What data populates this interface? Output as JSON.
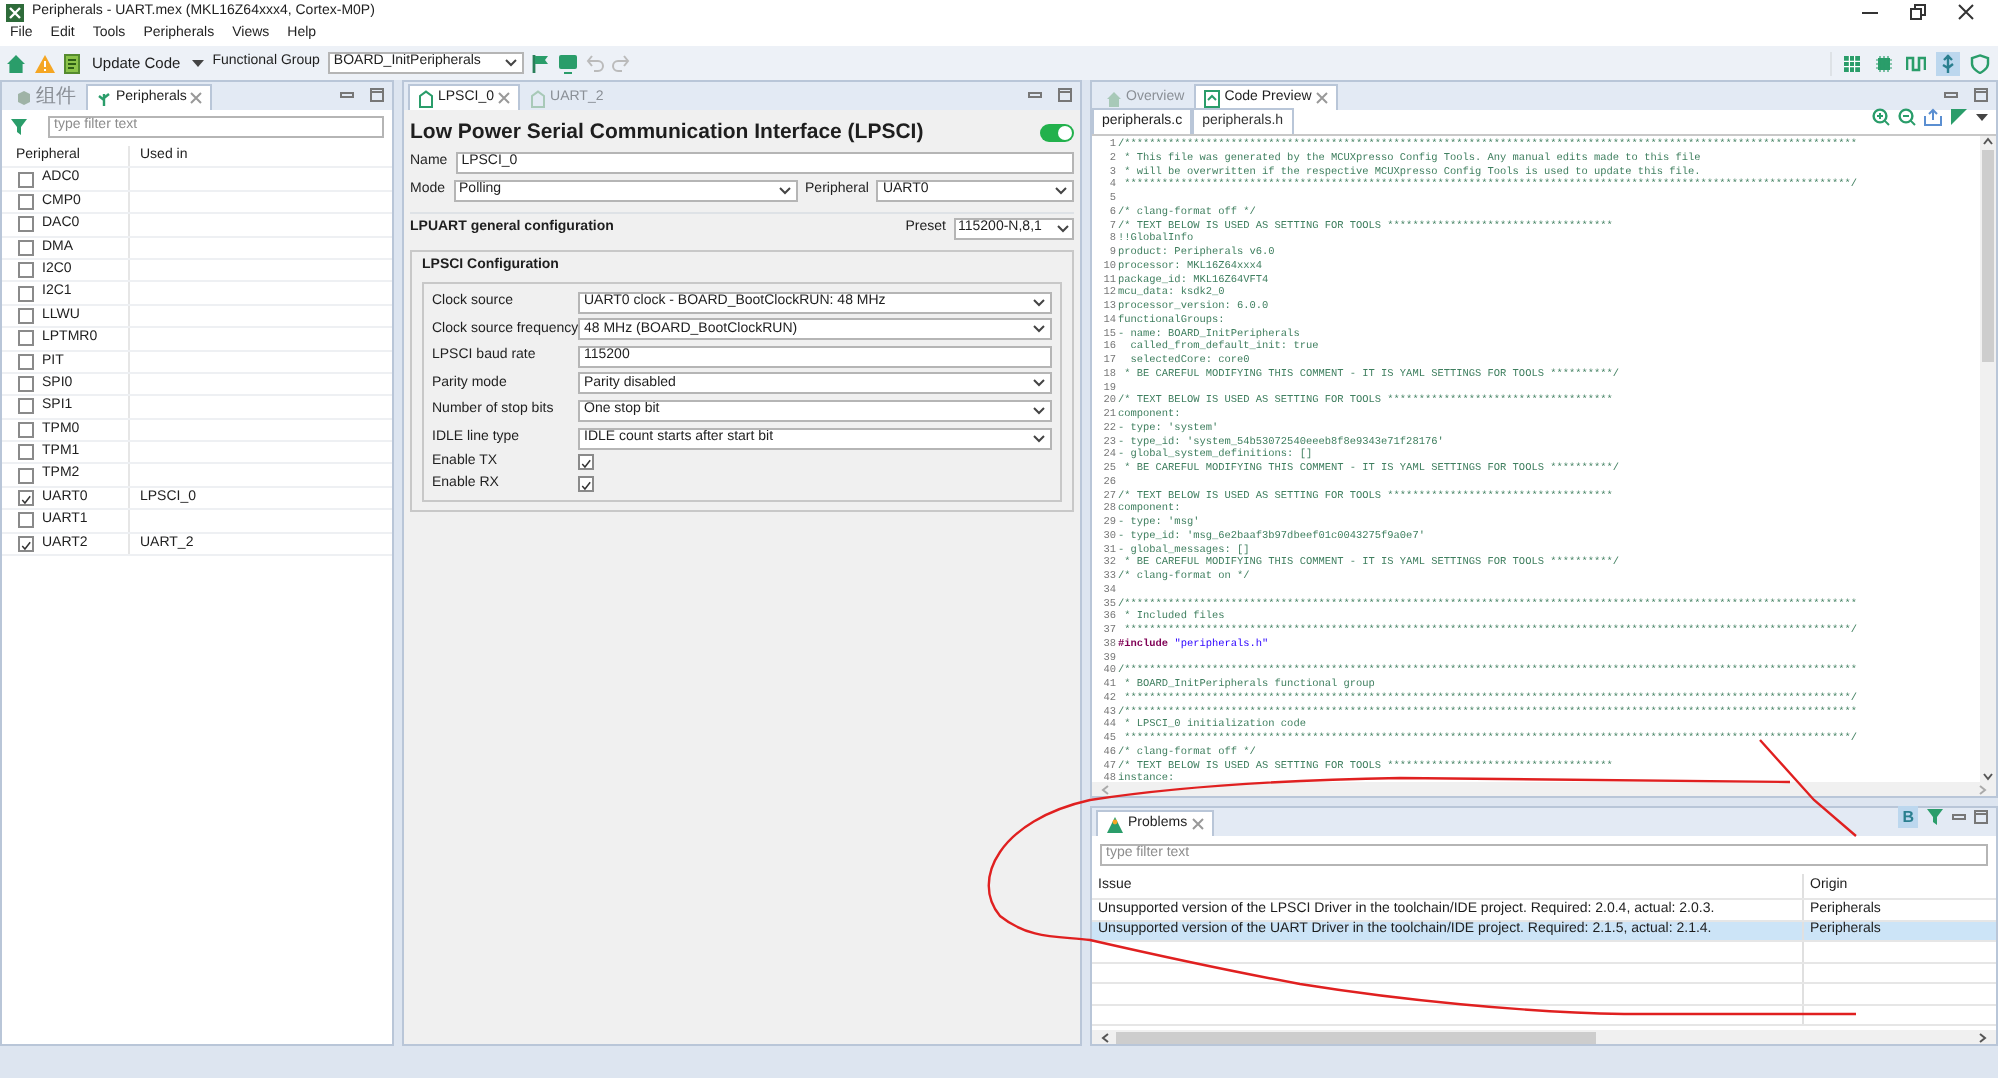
{
  "window": {
    "title": "Peripherals - UART.mex (MKL16Z64xxx4, Cortex-M0P)"
  },
  "menu": [
    "File",
    "Edit",
    "Tools",
    "Peripherals",
    "Views",
    "Help"
  ],
  "toolbar": {
    "update_button": "Update Code",
    "functional_group_label": "Functional Group",
    "functional_group": "BOARD_InitPeripherals",
    "perspectives": [
      {
        "kind": "grid",
        "selected": false
      },
      {
        "kind": "chip",
        "selected": false
      },
      {
        "kind": "wave",
        "selected": false
      },
      {
        "kind": "pin",
        "selected": true
      },
      {
        "kind": "shield",
        "selected": false
      }
    ]
  },
  "left_panel": {
    "tabs": [
      {
        "label": "组件",
        "selected": false
      },
      {
        "label": "Peripherals",
        "selected": true
      }
    ],
    "filter": {
      "placeholder": "type filter text"
    },
    "columns": [
      "Peripheral",
      "Used in"
    ],
    "rows": [
      {
        "name": "ADC0",
        "checked": false
      },
      {
        "name": "CMP0",
        "checked": false
      },
      {
        "name": "DAC0",
        "checked": false
      },
      {
        "name": "DMA",
        "checked": false
      },
      {
        "name": "I2C0",
        "checked": false
      },
      {
        "name": "I2C1",
        "checked": false
      },
      {
        "name": "LLWU",
        "checked": false
      },
      {
        "name": "LPTMR0",
        "checked": false
      },
      {
        "name": "PIT",
        "checked": false
      },
      {
        "name": "SPI0",
        "checked": false
      },
      {
        "name": "SPI1",
        "checked": false
      },
      {
        "name": "TPM0",
        "checked": false
      },
      {
        "name": "TPM1",
        "checked": false
      },
      {
        "name": "TPM2",
        "checked": false
      },
      {
        "name": "UART0",
        "checked": true,
        "used_in": "LPSCI_0"
      },
      {
        "name": "UART1",
        "checked": false
      },
      {
        "name": "UART2",
        "checked": true,
        "used_in": "UART_2"
      }
    ]
  },
  "editor": {
    "tabs": [
      {
        "label": "LPSCI_0",
        "selected": true
      },
      {
        "label": "UART_2",
        "selected": false
      }
    ],
    "title": "Low Power Serial Communication Interface (LPSCI)",
    "enabled": true,
    "name_label": "Name",
    "name": "LPSCI_0",
    "mode_label": "Mode",
    "mode": "Polling",
    "peripheral_label": "Peripheral",
    "peripheral": "UART0",
    "section": "LPUART general configuration",
    "preset_label": "Preset",
    "preset": "115200-N,8,1",
    "group": "LPSCI Configuration",
    "settings": [
      {
        "label": "Clock source",
        "kind": "select",
        "value": "UART0 clock - BOARD_BootClockRUN: 48 MHz"
      },
      {
        "label": "Clock source frequency",
        "kind": "select",
        "value": "48 MHz (BOARD_BootClockRUN)"
      },
      {
        "label": "LPSCI baud rate",
        "kind": "text",
        "value": "115200"
      },
      {
        "label": "Parity mode",
        "kind": "select",
        "value": "Parity disabled"
      },
      {
        "label": "Number of stop bits",
        "kind": "select",
        "value": "One stop bit"
      },
      {
        "label": "IDLE line type",
        "kind": "select",
        "value": "IDLE count starts after start bit"
      },
      {
        "label": "Enable TX",
        "kind": "checkbox",
        "checked": true
      },
      {
        "label": "Enable RX",
        "kind": "checkbox",
        "checked": true
      }
    ]
  },
  "code_preview": {
    "tabs": [
      {
        "label": "Overview",
        "selected": false
      },
      {
        "label": "Code Preview",
        "selected": true
      }
    ],
    "files": [
      {
        "label": "peripherals.c",
        "selected": true
      },
      {
        "label": "peripherals.h",
        "selected": false
      }
    ],
    "lines": [
      {
        "number": "1",
        "text": "/*********************************************************************************************************************"
      },
      {
        "number": "2",
        "text": " * This file was generated by the MCUXpresso Config Tools. Any manual edits made to this file"
      },
      {
        "number": "3",
        "text": " * will be overwritten if the respective MCUXpresso Config Tools is used to update this file."
      },
      {
        "number": "4",
        "text": " ********************************************************************************************************************/"
      },
      {
        "number": "5"
      },
      {
        "number": "6",
        "text": "/* clang-format off */"
      },
      {
        "number": "7",
        "text": "/* TEXT BELOW IS USED AS SETTING FOR TOOLS ************************************"
      },
      {
        "number": "8",
        "text": "!!GlobalInfo"
      },
      {
        "number": "9",
        "text": "product: Peripherals v6.0"
      },
      {
        "number": "10",
        "text": "processor: MKL16Z64xxx4"
      },
      {
        "number": "11",
        "text": "package_id: MKL16Z64VFT4"
      },
      {
        "number": "12",
        "text": "mcu_data: ksdk2_0"
      },
      {
        "number": "13",
        "text": "processor_version: 6.0.0"
      },
      {
        "number": "14",
        "text": "functionalGroups:"
      },
      {
        "number": "15",
        "text": "- name: BOARD_InitPeripherals"
      },
      {
        "number": "16",
        "text": "  called_from_default_init: true"
      },
      {
        "number": "17",
        "text": "  selectedCore: core0"
      },
      {
        "number": "18",
        "text": " * BE CAREFUL MODIFYING THIS COMMENT - IT IS YAML SETTINGS FOR TOOLS **********/"
      },
      {
        "number": "19"
      },
      {
        "number": "20",
        "text": "/* TEXT BELOW IS USED AS SETTING FOR TOOLS ************************************"
      },
      {
        "number": "21",
        "text": "component:"
      },
      {
        "number": "22",
        "text": "- type: 'system'"
      },
      {
        "number": "23",
        "text": "- type_id: 'system_54b53072540eeeb8f8e9343e71f28176'"
      },
      {
        "number": "24",
        "text": "- global_system_definitions: []"
      },
      {
        "number": "25",
        "text": " * BE CAREFUL MODIFYING THIS COMMENT - IT IS YAML SETTINGS FOR TOOLS **********/"
      },
      {
        "number": "26"
      },
      {
        "number": "27",
        "text": "/* TEXT BELOW IS USED AS SETTING FOR TOOLS ************************************"
      },
      {
        "number": "28",
        "text": "component:"
      },
      {
        "number": "29",
        "text": "- type: 'msg'"
      },
      {
        "number": "30",
        "text": "- type_id: 'msg_6e2baaf3b97dbeef01c0043275f9a0e7'"
      },
      {
        "number": "31",
        "text": "- global_messages: []"
      },
      {
        "number": "32",
        "text": " * BE CAREFUL MODIFYING THIS COMMENT - IT IS YAML SETTINGS FOR TOOLS **********/"
      },
      {
        "number": "33",
        "text": "/* clang-format on */"
      },
      {
        "number": "34"
      },
      {
        "number": "35",
        "text": "/*********************************************************************************************************************"
      },
      {
        "number": "36",
        "text": " * Included files"
      },
      {
        "number": "37",
        "text": " ********************************************************************************************************************/"
      },
      {
        "number": "38",
        "segments": [
          {
            "kind": "directive",
            "text": "#include"
          },
          {
            "kind": "string",
            "text": " \"peripherals.h\""
          }
        ]
      },
      {
        "number": "39"
      },
      {
        "number": "40",
        "text": "/*********************************************************************************************************************"
      },
      {
        "number": "41",
        "text": " * BOARD_InitPeripherals functional group"
      },
      {
        "number": "42",
        "text": " ********************************************************************************************************************/"
      },
      {
        "number": "43",
        "text": "/*********************************************************************************************************************"
      },
      {
        "number": "44",
        "text": " * LPSCI_0 initialization code"
      },
      {
        "number": "45",
        "text": " ********************************************************************************************************************/"
      },
      {
        "number": "46",
        "text": "/* clang-format off */"
      },
      {
        "number": "47",
        "text": "/* TEXT BELOW IS USED AS SETTING FOR TOOLS ************************************"
      },
      {
        "number": "48",
        "text": "instance:"
      }
    ]
  },
  "problems": {
    "tab": "Problems",
    "group_button": {
      "label": "B",
      "selected": true
    },
    "filter": {
      "placeholder": "type filter text"
    },
    "columns": [
      "Issue",
      "Origin"
    ],
    "rows": [
      {
        "issue": "Unsupported version of the LPSCI Driver in the toolchain/IDE project. Required: 2.0.4, actual: 2.0.3.",
        "origin": "Peripherals",
        "selected": false
      },
      {
        "issue": "Unsupported version of the UART Driver in the toolchain/IDE project. Required: 2.1.5, actual: 2.1.4.",
        "origin": "Peripherals",
        "selected": true
      }
    ]
  }
}
